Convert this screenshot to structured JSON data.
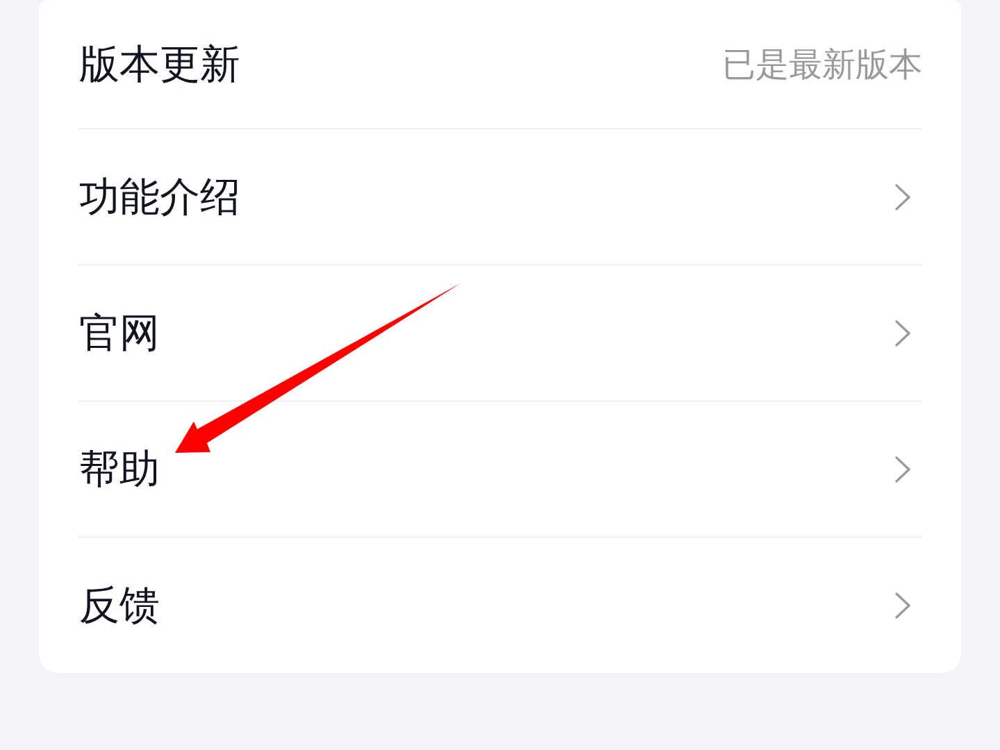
{
  "rows": [
    {
      "kind": "value",
      "label": "版本更新",
      "value": "已是最新版本"
    },
    {
      "kind": "link",
      "label": "功能介绍"
    },
    {
      "kind": "link",
      "label": "官网"
    },
    {
      "kind": "link",
      "label": "帮助"
    },
    {
      "kind": "link",
      "label": "反馈"
    }
  ]
}
